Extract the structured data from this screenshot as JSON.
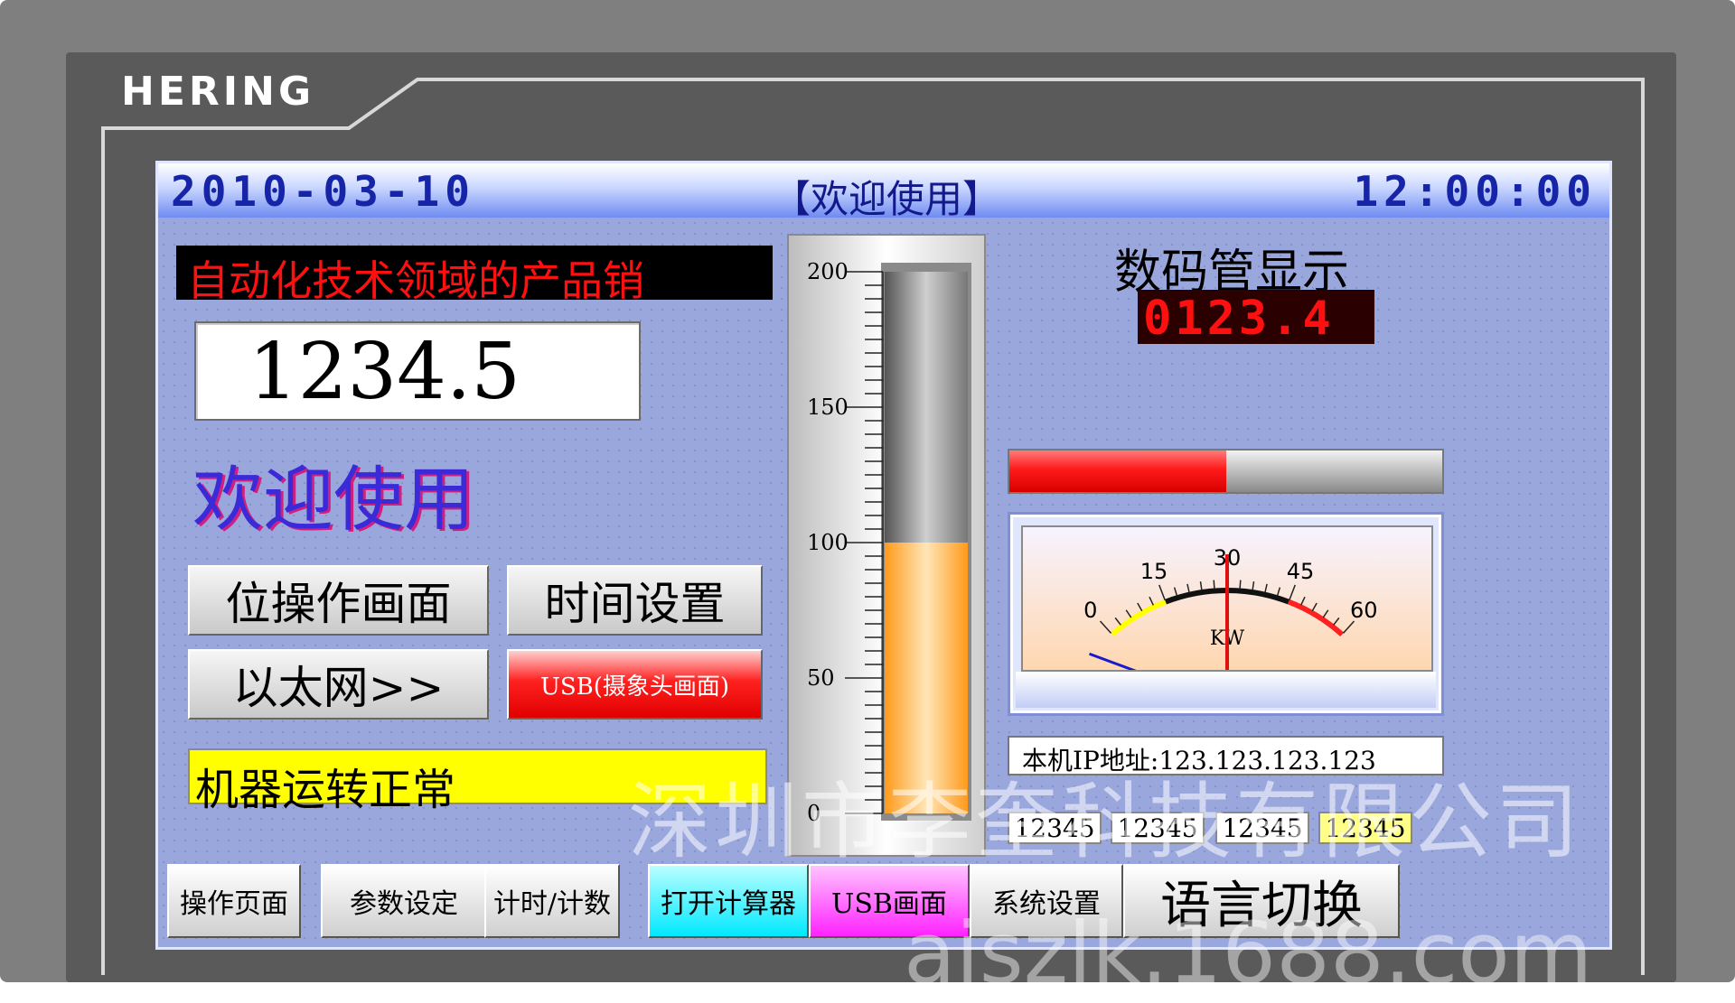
{
  "device": {
    "brand": "HERING"
  },
  "header": {
    "date": "2010-03-10",
    "title": "【欢迎使用】",
    "time": "12:00:00"
  },
  "left_panel": {
    "marquee_text": "自动化技术领域的产品销",
    "numeric_display": "1234.5",
    "welcome_text": "欢迎使用",
    "buttons": {
      "bit_operation": "位操作画面",
      "time_setting": "时间设置",
      "ethernet": "以太网>>",
      "usb_camera": "USB(摄象头画面)"
    },
    "status_message": "机器运转正常",
    "status_color": "#ffff00"
  },
  "tank_gauge": {
    "scale_labels": [
      "200",
      "150",
      "100",
      "50",
      "0"
    ],
    "min": 0,
    "max": 200,
    "value": 100,
    "fill_color": "#ffa323"
  },
  "digital_display": {
    "label": "数码管显示",
    "value": "0123.4",
    "color": "#ff1010"
  },
  "bar_graph": {
    "fraction": 0.5,
    "color": "#ff1a1a"
  },
  "meter": {
    "unit": "KW",
    "scale_labels": [
      "0",
      "15",
      "30",
      "45",
      "60"
    ],
    "min": 0,
    "max": 60,
    "needle_value": 30,
    "zones": [
      {
        "from": 0,
        "to": 15,
        "color": "#ffff00"
      },
      {
        "from": 15,
        "to": 45,
        "color": "#111111"
      },
      {
        "from": 45,
        "to": 60,
        "color": "#ff2020"
      }
    ]
  },
  "network": {
    "ip_label": "本机IP地址:",
    "ip_value": "123.123.123.123",
    "numeric_fields": [
      "12345",
      "12345",
      "12345",
      "12345"
    ]
  },
  "nav": {
    "items": [
      "操作页面",
      "参数设定",
      "计时/计数",
      "打开计算器",
      "USB画面",
      "系统设置",
      "语言切换"
    ],
    "calculator_color": "#00e8ff",
    "usb_color": "#ff22ff"
  },
  "watermarks": {
    "company": "深圳市李奎科技有限公司",
    "site": "aiszlk.1688.com"
  }
}
